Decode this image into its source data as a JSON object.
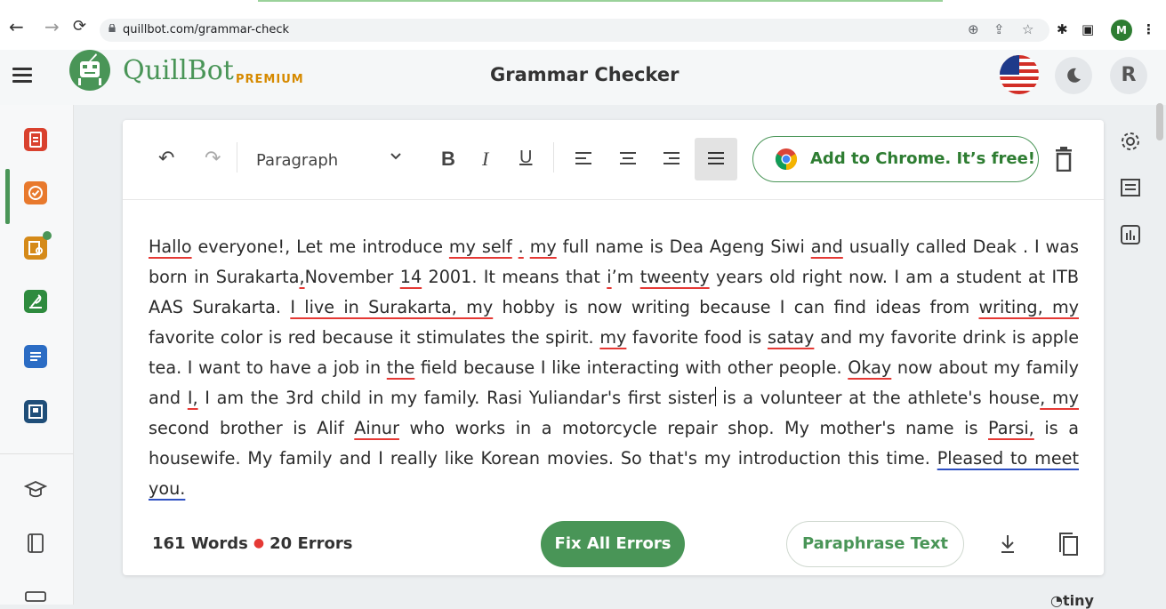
{
  "browser": {
    "url": "quillbot.com/grammar-check",
    "profile_initial": "M"
  },
  "app": {
    "logo_text": "QuillBot",
    "logo_badge": "PREMIUM",
    "page_title": "Grammar Checker",
    "user_initial": "R",
    "accent_color": "#499557",
    "error_color": "#e53935",
    "suggestion_color": "#2d4fc2"
  },
  "toolbar": {
    "paragraph_select": "Paragraph",
    "bold": "B",
    "italic": "I",
    "underline": "U",
    "chrome_cta": "Add to Chrome. It’s free!"
  },
  "document": {
    "text_runs": [
      {
        "t": "Hallo",
        "mark": "error"
      },
      {
        "t": " everyone!, Let me introduce ",
        "mark": null
      },
      {
        "t": "my self",
        "mark": "error"
      },
      {
        "t": " ",
        "mark": null
      },
      {
        "t": ".",
        "mark": "error"
      },
      {
        "t": " ",
        "mark": null
      },
      {
        "t": "my",
        "mark": "error"
      },
      {
        "t": " full name is Dea Ageng Siwi ",
        "mark": null
      },
      {
        "t": "and",
        "mark": "error"
      },
      {
        "t": " usually called Deak . I was born in Surakarta",
        "mark": null
      },
      {
        "t": ",",
        "mark": "error"
      },
      {
        "t": "November ",
        "mark": null
      },
      {
        "t": "14",
        "mark": "error"
      },
      {
        "t": " 2001. It means that ",
        "mark": null
      },
      {
        "t": "i",
        "mark": "error"
      },
      {
        "t": "’m ",
        "mark": null
      },
      {
        "t": "tweenty",
        "mark": "error"
      },
      {
        "t": " years old right now. I am a student at ITB AAS Surakarta. ",
        "mark": null
      },
      {
        "t": "I live in Surakarta, my",
        "mark": "error"
      },
      {
        "t": " hobby is now writing because I can find ideas from ",
        "mark": null
      },
      {
        "t": "writing, my",
        "mark": "error"
      },
      {
        "t": " favorite color is red because it stimulates the spirit. ",
        "mark": null
      },
      {
        "t": "my",
        "mark": "error"
      },
      {
        "t": " favorite food is ",
        "mark": null
      },
      {
        "t": "satay",
        "mark": "error"
      },
      {
        "t": " and my favorite drink is apple tea. I want to have a job in ",
        "mark": null
      },
      {
        "t": "the",
        "mark": "error"
      },
      {
        "t": " field because I like interacting with other people. ",
        "mark": null
      },
      {
        "t": "Okay",
        "mark": "error"
      },
      {
        "t": " now about my family and ",
        "mark": null
      },
      {
        "t": "I,",
        "mark": "error"
      },
      {
        "t": " I am the 3rd child in my family. Rasi Yuliandar's first sister",
        "mark": null
      },
      {
        "t": "",
        "mark": "caret"
      },
      {
        "t": " is a volunteer at the athlete's house",
        "mark": null
      },
      {
        "t": ", my",
        "mark": "error"
      },
      {
        "t": " second brother is Alif ",
        "mark": null
      },
      {
        "t": "Ainur",
        "mark": "error"
      },
      {
        "t": " who works in a motorcycle repair shop. My mother's name is ",
        "mark": null
      },
      {
        "t": "Parsi,",
        "mark": "error"
      },
      {
        "t": " is a housewife. My family and I really like Korean movies. So that's my introduction this time. ",
        "mark": null
      },
      {
        "t": "Pleased to meet you.",
        "mark": "suggestion"
      }
    ]
  },
  "footer": {
    "word_count": "161 Words",
    "error_count": "20 Errors",
    "fix_all_label": "Fix All Errors",
    "paraphrase_label": "Paraphrase Text"
  },
  "branding": {
    "tiny_label": "tiny"
  }
}
